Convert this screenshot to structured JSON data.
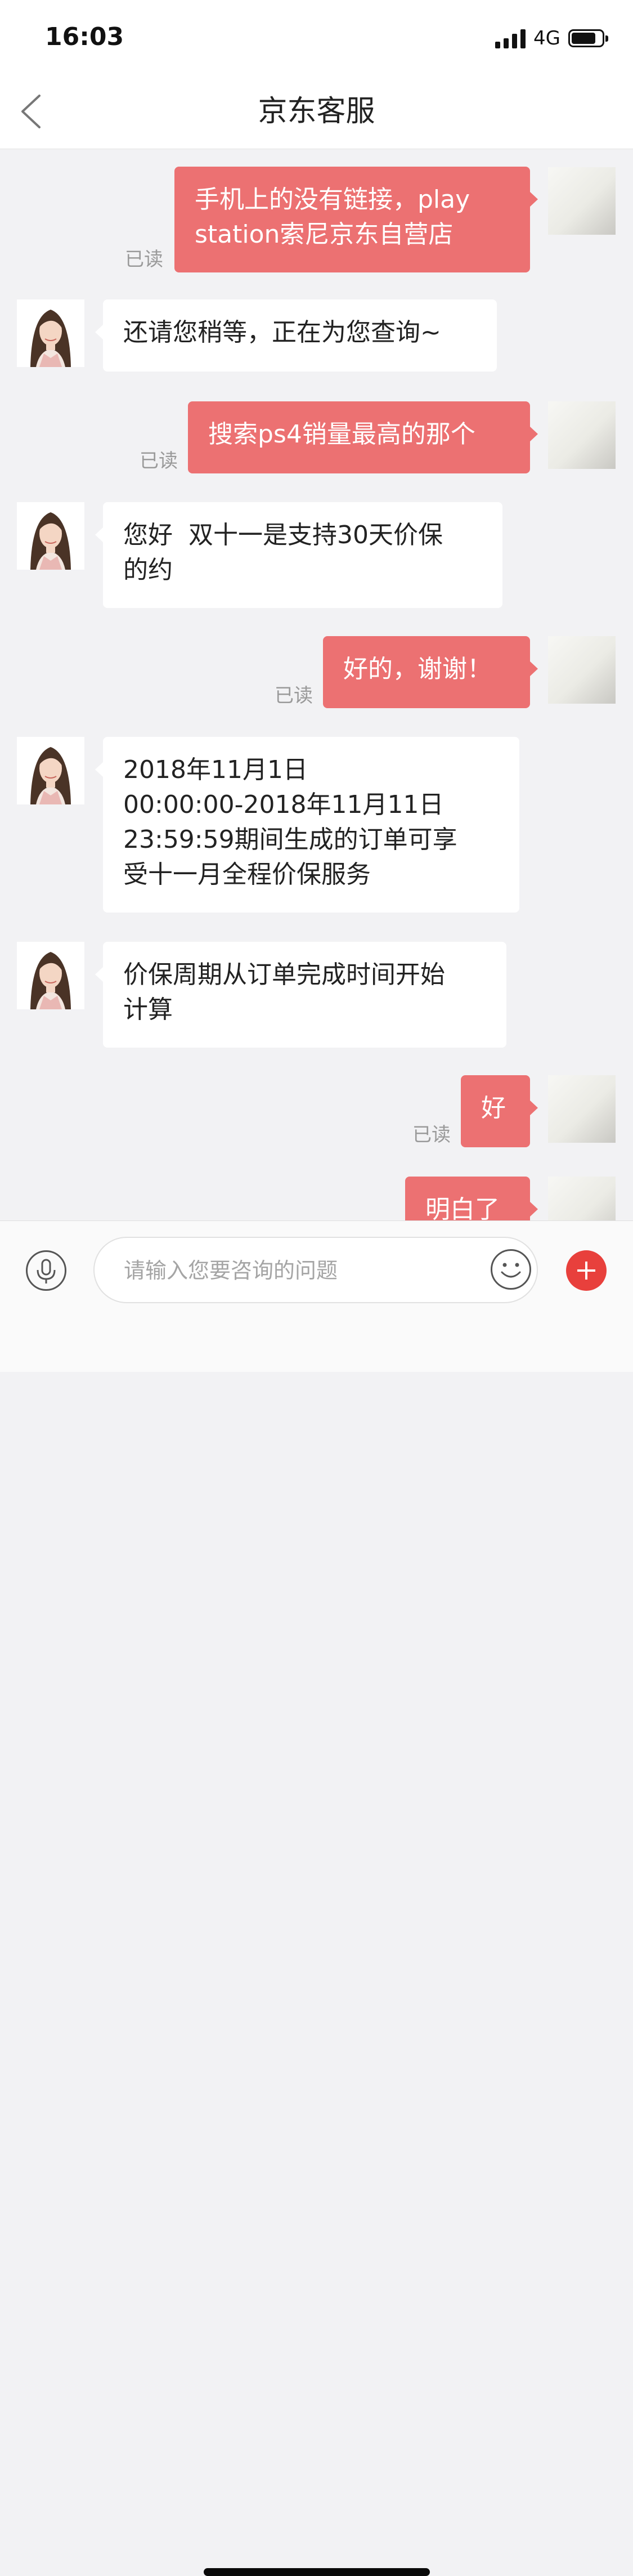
{
  "status_bar": {
    "time": "16:03",
    "network": "4G",
    "battery_level": 0.8
  },
  "header": {
    "title": "京东客服",
    "back_icon": "chevron-left-icon"
  },
  "messages": [
    {
      "from": "user",
      "lines": [
        "手机上的没有链接，play",
        "station索尼京东自营店"
      ],
      "read_label": "已读"
    },
    {
      "from": "agent",
      "lines": [
        "还请您稍等，正在为您查询~"
      ]
    },
    {
      "from": "user",
      "lines": [
        "搜索ps4销量最高的那个"
      ],
      "read_label": "已读"
    },
    {
      "from": "agent",
      "lines": [
        "您好  双十一是支持30天价保",
        "的约"
      ]
    },
    {
      "from": "user",
      "lines": [
        "好的，谢谢！"
      ],
      "read_label": "已读"
    },
    {
      "from": "agent",
      "lines": [
        "2018年11月1日",
        "00:00:00-2018年11月11日",
        "23:59:59期间生成的订单可享",
        "受十一月全程价保服务"
      ]
    },
    {
      "from": "agent",
      "lines": [
        "价保周期从订单完成时间开始",
        "计算"
      ]
    },
    {
      "from": "user",
      "lines": [
        "好"
      ],
      "read_label": "已读"
    },
    {
      "from": "user",
      "lines": [
        "明白了"
      ]
    }
  ],
  "input_bar": {
    "placeholder": "请输入您要咨询的问题",
    "voice_icon": "microphone-icon",
    "emoji_icon": "smiley-icon",
    "more_icon": "plus-icon"
  },
  "colors": {
    "outgoing_bubble": "#ec7172",
    "incoming_bubble": "#ffffff",
    "chat_background": "#f2f2f4",
    "plus_button": "#e8403c"
  }
}
